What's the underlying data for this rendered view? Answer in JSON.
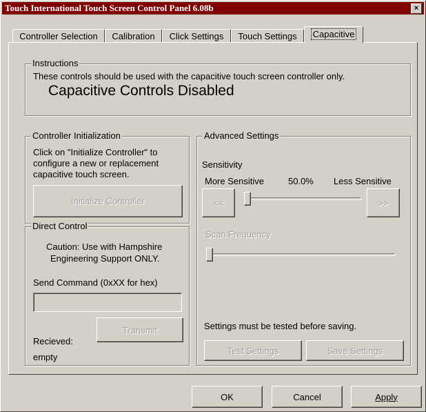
{
  "window": {
    "title": "Touch International Touch Screen Control Panel 6.08b",
    "close_glyph": "×"
  },
  "tabs": [
    {
      "label": "Controller Selection",
      "active": false
    },
    {
      "label": "Calibration",
      "active": false
    },
    {
      "label": "Click Settings",
      "active": false
    },
    {
      "label": "Touch Settings",
      "active": false
    },
    {
      "label": "Capacitive",
      "active": true
    }
  ],
  "instructions": {
    "label": "Instructions",
    "text": "These controls should be used with the capacitive touch screen controller only.",
    "status": "Capacitive Controls Disabled"
  },
  "controller_init": {
    "label": "Controller Initialization",
    "text_lines": [
      "Click on \"Initialize Controller\" to",
      "configure a new or replacement",
      "capacitive touch screen."
    ],
    "button_label": "Initialize Controller"
  },
  "direct_control": {
    "label": "Direct Control",
    "caution_lines": [
      "Caution: Use with Hampshire",
      "Engineering Support ONLY."
    ],
    "send_label": "Send Command (0xXX for hex)",
    "send_value": "",
    "transmit_label": "Transmit",
    "received_label": "Recieved:",
    "received_value": "empty"
  },
  "advanced": {
    "label": "Advanced Settings",
    "sensitivity_label": "Sensitivity",
    "more_label": "More Sensitive",
    "value_label": "50.0%",
    "less_label": "Less Sensitive",
    "dec_label": "<<",
    "inc_label": ">>",
    "sensitivity_position": 0.0,
    "scan_label": "Scan Frequency",
    "scan_position": 0.0,
    "note": "Settings must be tested before saving.",
    "test_label": "Test Settings",
    "save_label": "Save Settings"
  },
  "footer": {
    "ok_label": "OK",
    "cancel_label": "Cancel",
    "apply_label": "Apply"
  }
}
